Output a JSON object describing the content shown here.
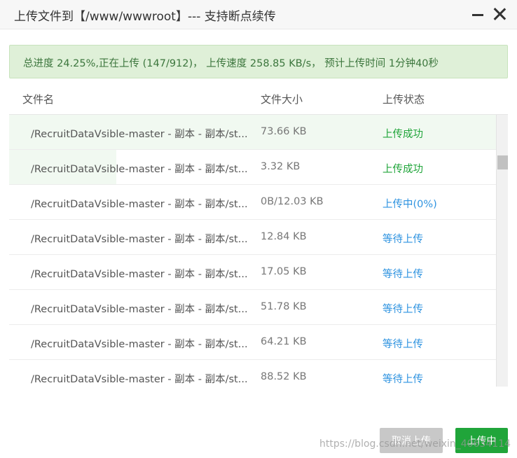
{
  "window": {
    "title": "上传文件到【/www/wwwroot】--- 支持断点续传"
  },
  "progress": {
    "text": "总进度 24.25%,正在上传 (147/912)， 上传速度 258.85 KB/s， 预计上传时间 1分钟40秒"
  },
  "table": {
    "headers": {
      "name": "文件名",
      "size": "文件大小",
      "status": "上传状态"
    },
    "rows": [
      {
        "name": "/RecruitDataVsible-master - 副本 - 副本/st...",
        "size": "73.66 KB",
        "status": "上传成功"
      },
      {
        "name": "/RecruitDataVsible-master - 副本 - 副本/st...",
        "size": "3.32 KB",
        "status": "上传成功"
      },
      {
        "name": "/RecruitDataVsible-master - 副本 - 副本/st...",
        "size": "0B/12.03 KB",
        "status": "上传中(0%)"
      },
      {
        "name": "/RecruitDataVsible-master - 副本 - 副本/st...",
        "size": "12.84 KB",
        "status": "等待上传"
      },
      {
        "name": "/RecruitDataVsible-master - 副本 - 副本/st...",
        "size": "17.05 KB",
        "status": "等待上传"
      },
      {
        "name": "/RecruitDataVsible-master - 副本 - 副本/st...",
        "size": "51.78 KB",
        "status": "等待上传"
      },
      {
        "name": "/RecruitDataVsible-master - 副本 - 副本/st...",
        "size": "64.21 KB",
        "status": "等待上传"
      },
      {
        "name": "/RecruitDataVsible-master - 副本 - 副本/st...",
        "size": "88.52 KB",
        "status": "等待上传"
      }
    ]
  },
  "buttons": {
    "cancel": "取消上传",
    "upload": "上传中"
  },
  "watermark": "https://blog.csdn.net/weixin_40634114",
  "colors": {
    "success": "#20a53a",
    "info": "#2e93e0",
    "banner_bg": "#dff0d8"
  }
}
